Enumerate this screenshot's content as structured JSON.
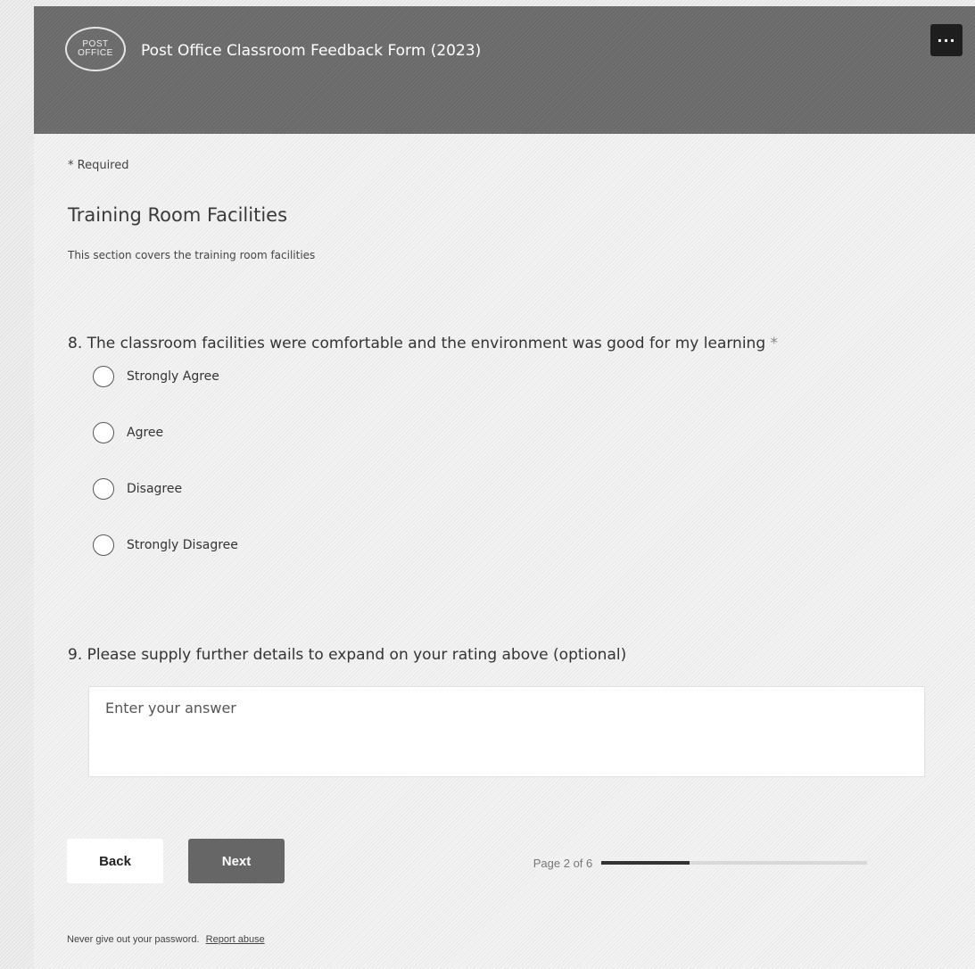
{
  "header": {
    "logo_line1": "POST",
    "logo_line2": "OFFICE",
    "title": "Post Office Classroom Feedback Form (2023)",
    "more_label": "···"
  },
  "required_note": "* Required",
  "section": {
    "title": "Training Room Facilities",
    "description": "This section covers the training room facilities"
  },
  "question8": {
    "text": "8. The classroom facilities were comfortable and the environment was good for my learning",
    "required_mark": "*",
    "options": [
      "Strongly Agree",
      "Agree",
      "Disagree",
      "Strongly Disagree"
    ]
  },
  "question9": {
    "text": "9. Please supply further details to expand on your rating above (optional)",
    "placeholder": "Enter your answer",
    "value": ""
  },
  "navigation": {
    "back_label": "Back",
    "next_label": "Next",
    "page_text": "Page 2 of 6",
    "progress_fraction": 0.33
  },
  "footer": {
    "text": "Never give out your password.",
    "link": "Report abuse"
  },
  "colors": {
    "header_bg": "#6a6a6a",
    "next_bg": "#666666",
    "progress_fill": "#333333"
  }
}
